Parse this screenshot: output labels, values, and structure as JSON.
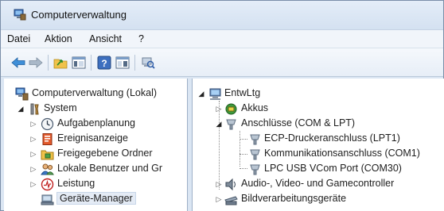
{
  "window": {
    "title": "Computerverwaltung"
  },
  "menu": [
    "Datei",
    "Aktion",
    "Ansicht",
    "?"
  ],
  "toolbar": {
    "buttons": [
      "back-arrow-icon",
      "forward-arrow-icon",
      "up-folder-icon",
      "show-hide-tree-icon",
      "help-icon",
      "properties-icon",
      "scan-hardware-icon"
    ]
  },
  "left_tree": {
    "root": "Computerverwaltung (Lokal)",
    "system": "System",
    "items": [
      "Aufgabenplanung",
      "Ereignisanzeige",
      "Freigegebene Ordner",
      "Lokale Benutzer und Gr",
      "Leistung",
      "Geräte-Manager"
    ]
  },
  "right_tree": {
    "root": "EntwLtg",
    "akkus": "Akkus",
    "anschluesse": "Anschlüsse (COM & LPT)",
    "ports": [
      "ECP-Druckeranschluss (LPT1)",
      "Kommunikationsanschluss (COM1)",
      "LPC USB VCom Port (COM30)"
    ],
    "audio": "Audio-, Video- und Gamecontroller",
    "bild": "Bildverarbeitungsgeräte"
  }
}
